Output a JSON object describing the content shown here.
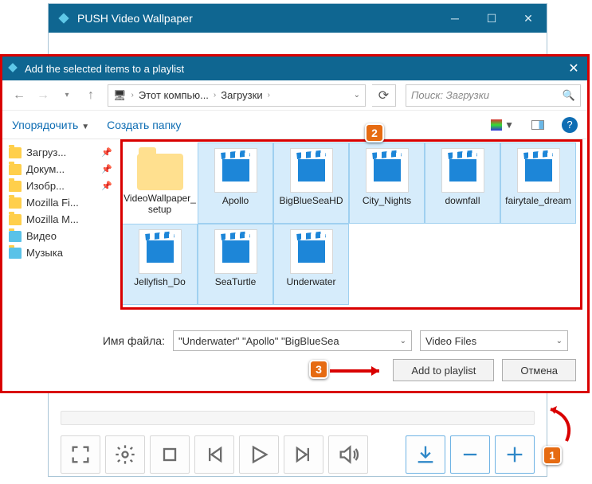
{
  "parent_window": {
    "title": "PUSH Video Wallpaper"
  },
  "dialog": {
    "title": "Add the selected items to a playlist",
    "breadcrumb": {
      "seg1": "Этот компью...",
      "seg2": "Загрузки"
    },
    "search_placeholder": "Поиск: Загрузки",
    "toolbar": {
      "organize": "Упорядочить",
      "new_folder": "Создать папку"
    },
    "sidebar": [
      {
        "label": "Загруз...",
        "pinned": true
      },
      {
        "label": "Докум...",
        "pinned": true
      },
      {
        "label": "Изобр...",
        "pinned": true
      },
      {
        "label": "Mozilla Fi...",
        "pinned": false
      },
      {
        "label": "Mozilla M...",
        "pinned": false
      },
      {
        "label": "Видео",
        "pinned": false,
        "alt": true
      },
      {
        "label": "Музыка",
        "pinned": false,
        "alt": true
      }
    ],
    "files": [
      {
        "label": "VideoWallpaper_setup",
        "type": "folder",
        "selected": false
      },
      {
        "label": "Apollo",
        "type": "video",
        "selected": true
      },
      {
        "label": "BigBlueSeaHD",
        "type": "video",
        "selected": true
      },
      {
        "label": "City_Nights",
        "type": "video",
        "selected": true
      },
      {
        "label": "downfall",
        "type": "video",
        "selected": true
      },
      {
        "label": "fairytale_dream",
        "type": "video",
        "selected": true
      },
      {
        "label": "Jellyfish_Do",
        "type": "video",
        "selected": true
      },
      {
        "label": "SeaTurtle",
        "type": "video",
        "selected": true
      },
      {
        "label": "Underwater",
        "type": "video",
        "selected": true
      }
    ],
    "filename_label": "Имя файла:",
    "filename_value": "\"Underwater\" \"Apollo\" \"BigBlueSea",
    "filter_value": "Video Files",
    "btn_open": "Add to playlist",
    "btn_cancel": "Отмена"
  },
  "callouts": {
    "c1": "1",
    "c2": "2",
    "c3": "3"
  }
}
